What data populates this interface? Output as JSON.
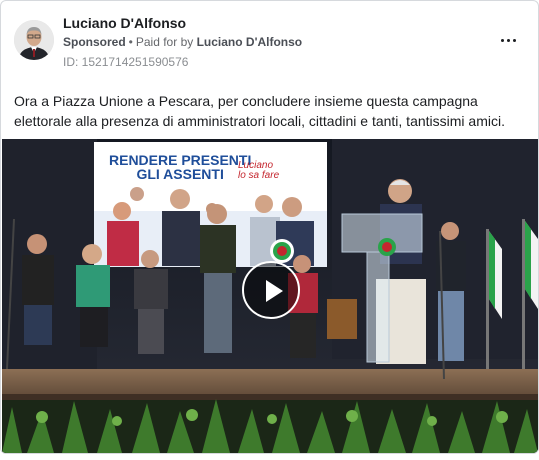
{
  "post": {
    "author": "Luciano D'Alfonso",
    "sponsored": "Sponsored",
    "separator": "•",
    "paid_for_by_prefix": "Paid for by",
    "paid_for_by": "Luciano D'Alfonso",
    "id_label": "ID: 1521714251590576",
    "text": "Ora a Piazza Unione a Pescara, per concludere insieme questa campagna elettorale alla presenza di amministratori locali, cittadini e tanti, tantissimi amici."
  },
  "media": {
    "screen_title_line1": "RENDERE PRESENTI",
    "screen_title_line2": "GLI ASSENTI",
    "screen_logo_line1": "Luciano",
    "screen_logo_line2": "lo sa fare"
  },
  "icons": {
    "more": "more-options-icon",
    "play": "play-icon"
  },
  "colors": {
    "text_primary": "#1c1e21",
    "text_secondary": "#65676b",
    "border": "#d6d9dd",
    "screen_blue": "#1f4e9a",
    "party_red": "#c4262e"
  }
}
